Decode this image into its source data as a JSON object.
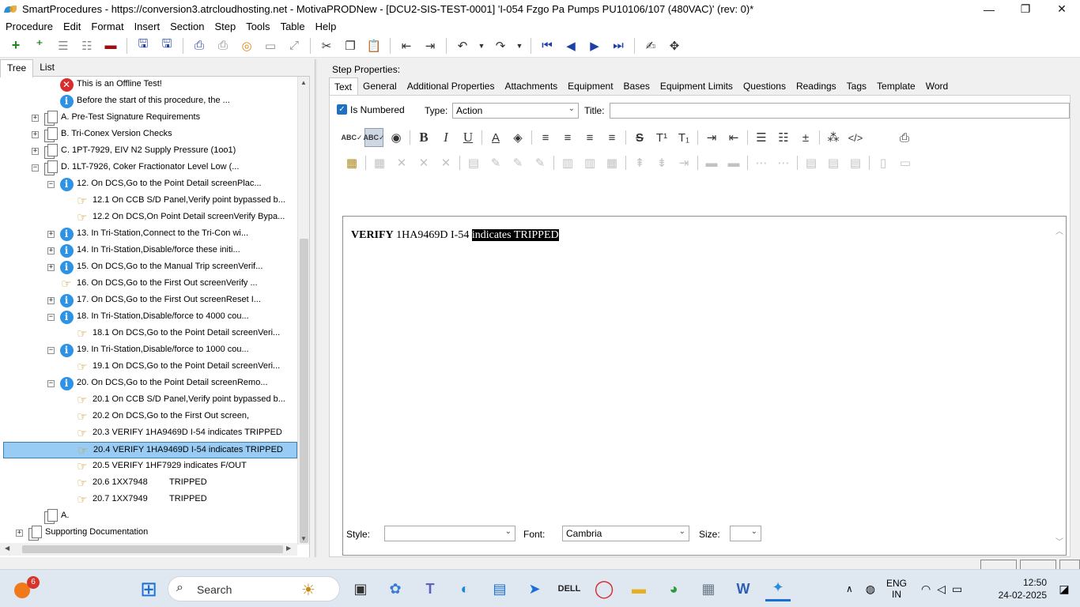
{
  "window": {
    "title": "SmartProcedures - https://conversion3.atrcloudhosting.net - MotivaPRODNew - [DCU2-SIS-TEST-0001] 'I-054 Fzgo Pa Pumps PU10106/107 (480VAC)' (rev: 0)*",
    "minimize": "—",
    "restore": "❐",
    "close": "✕"
  },
  "menu": [
    "Procedure",
    "Edit",
    "Format",
    "Insert",
    "Section",
    "Step",
    "Tools",
    "Table",
    "Help"
  ],
  "left_tabs": [
    "Tree",
    "List"
  ],
  "tree": [
    {
      "level": 2,
      "icon": "error-icon",
      "label": "This is an Offline Test!",
      "exp": ""
    },
    {
      "level": 2,
      "icon": "info-icon",
      "label": "Before the start of this procedure, the ...",
      "exp": ""
    },
    {
      "level": 1,
      "icon": "section-icon",
      "label": "A. Pre-Test Signature Requirements",
      "exp": "+"
    },
    {
      "level": 1,
      "icon": "section-icon",
      "label": "B. Tri-Conex Version Checks",
      "exp": "+"
    },
    {
      "level": 1,
      "icon": "section-icon",
      "label": "C. 1PT-7929, EIV N2 Supply Pressure (1oo1)",
      "exp": "+"
    },
    {
      "level": 1,
      "icon": "section-icon",
      "label": "D. 1LT-7926, Coker Fractionator Level Low (...",
      "exp": "−"
    },
    {
      "level": 2,
      "icon": "info-icon",
      "label": "12. On DCS,Go to the Point Detail screenPlac...",
      "exp": "−"
    },
    {
      "level": 3,
      "icon": "hand-icon",
      "label": "12.1 On CCB S/D Panel,Verify point bypassed b...",
      "exp": ""
    },
    {
      "level": 3,
      "icon": "hand-icon",
      "label": "12.2 On DCS,On Point Detail screenVerify Bypa...",
      "exp": ""
    },
    {
      "level": 2,
      "icon": "info-icon",
      "label": "13. In Tri-Station,Connect to the Tri-Con wi...",
      "exp": "+"
    },
    {
      "level": 2,
      "icon": "info-icon",
      "label": "14. In Tri-Station,Disable/force these initi...",
      "exp": "+"
    },
    {
      "level": 2,
      "icon": "info-icon",
      "label": "15. On DCS,Go to the Manual Trip screenVerif...",
      "exp": "+"
    },
    {
      "level": 2,
      "icon": "hand-icon",
      "label": "16. On DCS,Go to the First Out screenVerify ...",
      "exp": ""
    },
    {
      "level": 2,
      "icon": "info-icon",
      "label": "17. On DCS,Go to the First Out screenReset I...",
      "exp": "+"
    },
    {
      "level": 2,
      "icon": "info-icon",
      "label": "18. In Tri-Station,Disable/force to 4000 cou...",
      "exp": "−"
    },
    {
      "level": 3,
      "icon": "hand-icon",
      "label": "18.1 On DCS,Go to the Point Detail screenVeri...",
      "exp": ""
    },
    {
      "level": 2,
      "icon": "info-icon",
      "label": "19. In Tri-Station,Disable/force to 1000 cou...",
      "exp": "−"
    },
    {
      "level": 3,
      "icon": "hand-icon",
      "label": "19.1 On DCS,Go to the Point Detail screenVeri...",
      "exp": ""
    },
    {
      "level": 2,
      "icon": "info-icon",
      "label": "20. On DCS,Go to the Point Detail screenRemo...",
      "exp": "−"
    },
    {
      "level": 3,
      "icon": "hand-icon",
      "label": "20.1 On CCB S/D Panel,Verify point bypassed b...",
      "exp": ""
    },
    {
      "level": 3,
      "icon": "hand-icon",
      "label": "20.2 On DCS,Go to the First Out screen,",
      "exp": ""
    },
    {
      "level": 3,
      "icon": "hand-icon",
      "label": "20.3 VERIFY 1HA9469D I-54 indicates TRIPPED",
      "exp": ""
    },
    {
      "level": 3,
      "icon": "hand-icon",
      "label": "20.4 VERIFY 1HA9469D I-54 indicates TRIPPED",
      "exp": "",
      "selected": true
    },
    {
      "level": 3,
      "icon": "hand-icon",
      "label": "20.5 VERIFY 1HF7929 indicates F/OUT",
      "exp": ""
    },
    {
      "level": 3,
      "icon": "hand-icon",
      "label": "20.6 1XX7948         TRIPPED",
      "exp": ""
    },
    {
      "level": 3,
      "icon": "hand-icon",
      "label": "20.7 1XX7949         TRIPPED",
      "exp": ""
    },
    {
      "level": 1,
      "icon": "section-icon",
      "label": "A.",
      "exp": ""
    },
    {
      "level": 0,
      "icon": "section-icon",
      "label": "Supporting Documentation",
      "exp": "+"
    }
  ],
  "step_properties": {
    "label": "Step Properties:",
    "tabs": [
      "Text",
      "General",
      "Additional Properties",
      "Attachments",
      "Equipment",
      "Bases",
      "Equipment Limits",
      "Questions",
      "Readings",
      "Tags",
      "Template",
      "Word"
    ],
    "is_numbered_label": "Is Numbered",
    "type_label": "Type:",
    "type_value": "Action",
    "title_label": "Title:",
    "title_value": ""
  },
  "editor": {
    "bold_part": "VERIFY",
    "normal_part": " 1HA9469D I-54 ",
    "highlighted_part": "indicates TRIPPED"
  },
  "bottom": {
    "style_label": "Style:",
    "style_value": "",
    "font_label": "Font:",
    "font_value": "Cambria",
    "size_label": "Size:",
    "size_value": ""
  },
  "taskbar": {
    "weather_badge": "6",
    "search_text": "Search",
    "lang_line1": "ENG",
    "lang_line2": "IN",
    "time": "12:50",
    "date": "24-02-2025"
  }
}
